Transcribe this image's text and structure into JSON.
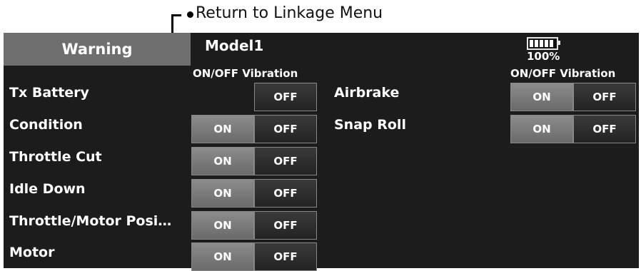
{
  "annotation": {
    "text": "Return to Linkage Menu"
  },
  "header": {
    "tab_label": "Warning",
    "model_name": "Model1",
    "battery_percent": "100%"
  },
  "columns": {
    "left_header": "ON/OFF Vibration",
    "right_header": "ON/OFF Vibration"
  },
  "left_rows": [
    {
      "label": "Tx Battery",
      "on": "",
      "vibration": "OFF"
    },
    {
      "label": "Condition",
      "on": "ON",
      "vibration": "OFF"
    },
    {
      "label": "Throttle Cut",
      "on": "ON",
      "vibration": "OFF"
    },
    {
      "label": "Idle Down",
      "on": "ON",
      "vibration": "OFF"
    },
    {
      "label": "Throttle/Motor Posi…",
      "on": "ON",
      "vibration": "OFF"
    },
    {
      "label": "Motor",
      "on": "ON",
      "vibration": "OFF"
    }
  ],
  "right_rows": [
    {
      "label": "Airbrake",
      "on": "ON",
      "vibration": "OFF"
    },
    {
      "label": "Snap Roll",
      "on": "ON",
      "vibration": "OFF"
    }
  ]
}
